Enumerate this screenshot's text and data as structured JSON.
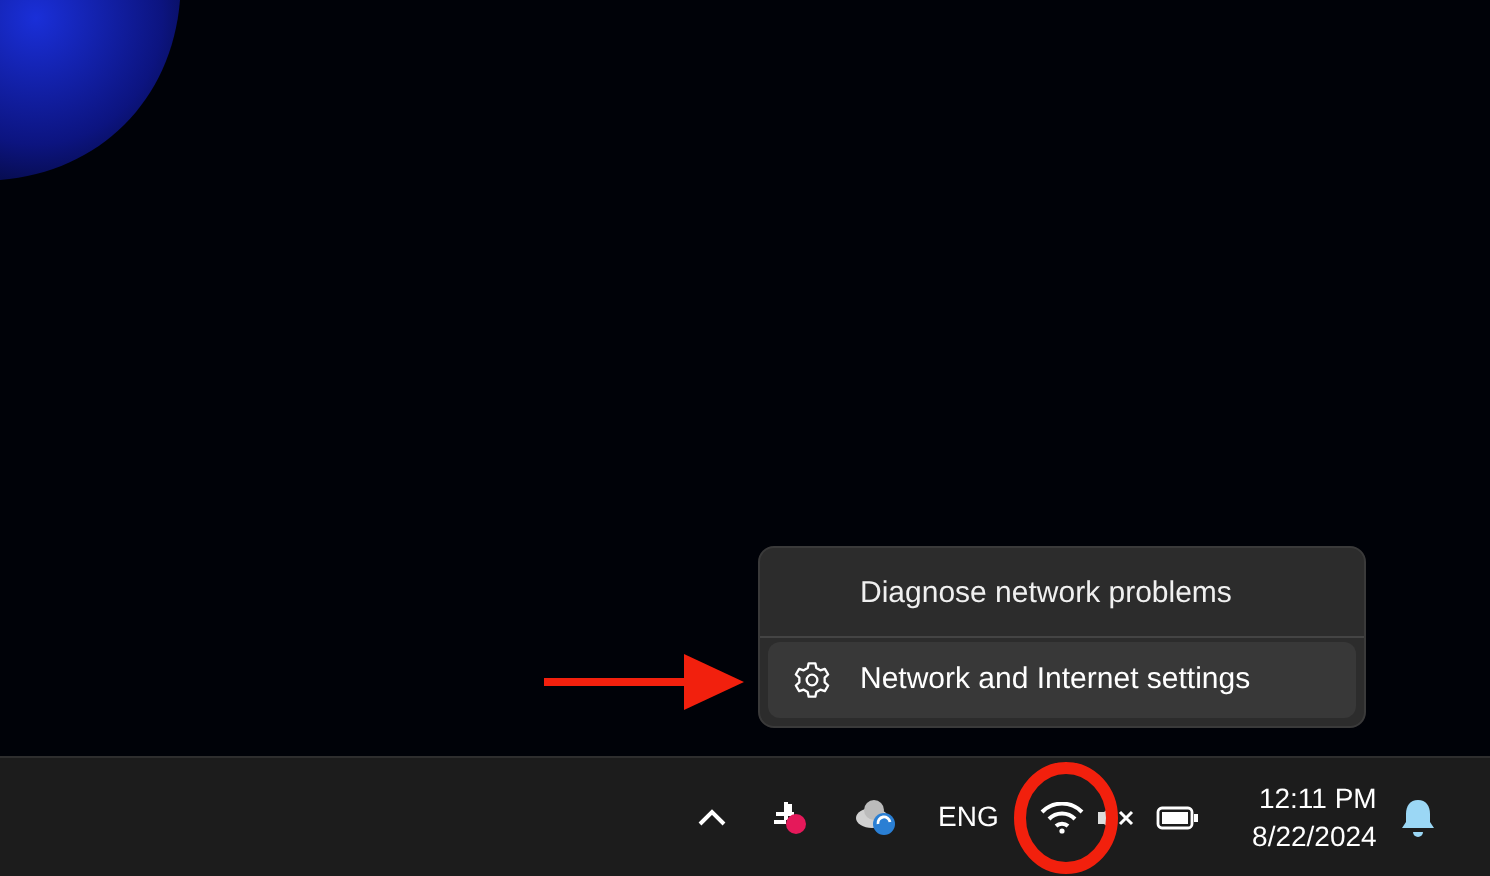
{
  "context_menu": {
    "items": [
      {
        "label": "Diagnose network problems",
        "kind": "text",
        "selected": false
      },
      {
        "label": "Network and Internet settings",
        "kind": "settings",
        "selected": true
      }
    ]
  },
  "taskbar": {
    "language": "ENG",
    "time": "12:11 PM",
    "date": "8/22/2024"
  }
}
